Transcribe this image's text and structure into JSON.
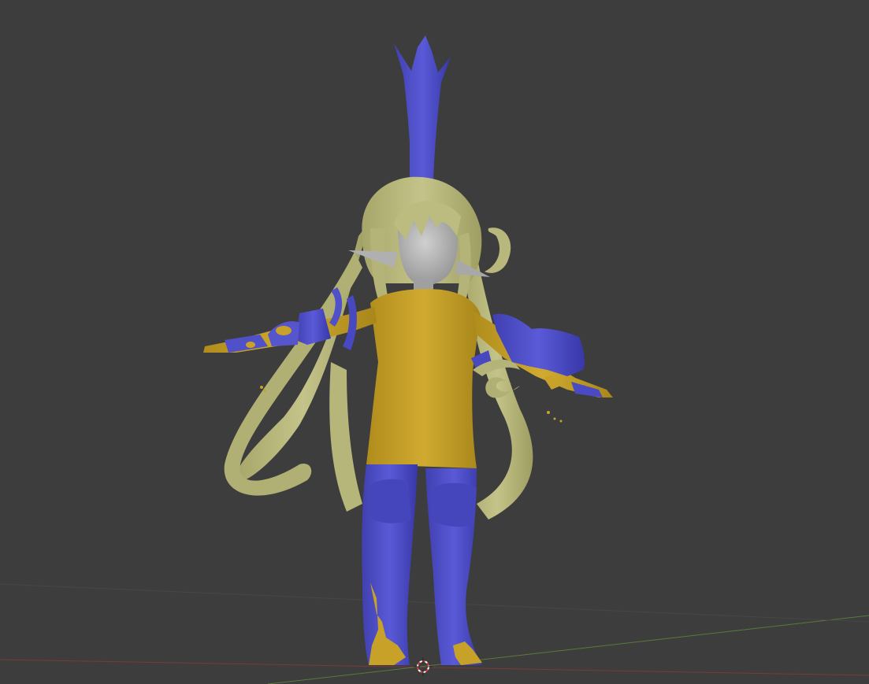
{
  "viewport": {
    "name": "3D Viewport",
    "background_color": "#3d3d3d",
    "grid": {
      "x_axis_color": "#7a3a3a",
      "y_axis_color": "#5a7a3a",
      "line_color": "#484848"
    },
    "cursor_icon": "3d-cursor-icon",
    "model": {
      "hair_color": "#b8b878",
      "skin_color": "#c8a228",
      "armor_color": "#5050c8",
      "face_color": "#b4b4b4"
    }
  }
}
